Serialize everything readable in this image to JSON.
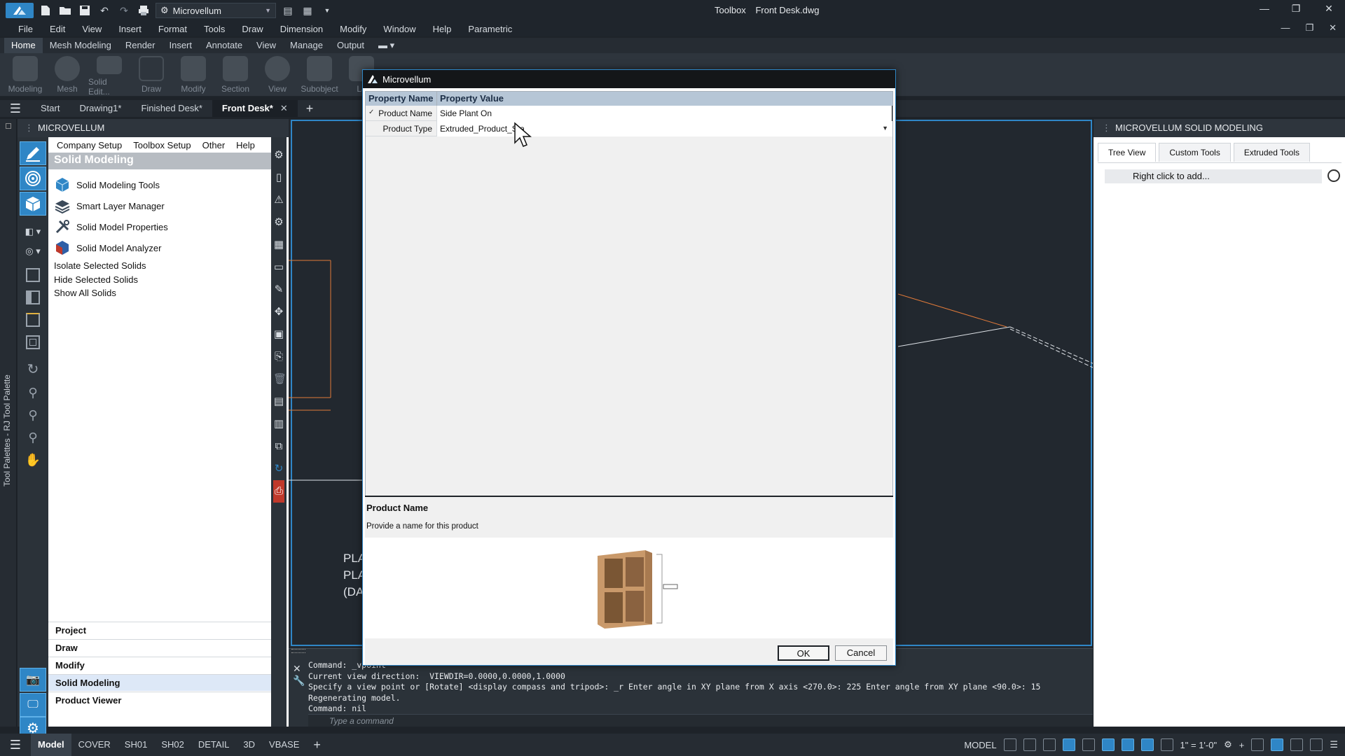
{
  "titlebar": {
    "workspace": "Microvellum",
    "app_name": "Toolbox",
    "file_name": "Front Desk.dwg"
  },
  "menubar": {
    "items": [
      "File",
      "Edit",
      "View",
      "Insert",
      "Format",
      "Tools",
      "Draw",
      "Dimension",
      "Modify",
      "Window",
      "Help",
      "Parametric"
    ]
  },
  "ribbon": {
    "tabs": [
      "Home",
      "Mesh Modeling",
      "Render",
      "Insert",
      "Annotate",
      "View",
      "Manage",
      "Output"
    ],
    "active_tab": "Home",
    "buttons": [
      "Modeling",
      "Mesh",
      "Solid Edit...",
      "Draw",
      "Modify",
      "Section",
      "View",
      "Subobject",
      "La"
    ]
  },
  "doc_tabs": {
    "items": [
      "Start",
      "Drawing1*",
      "Finished Desk*",
      "Front Desk*"
    ],
    "active": "Front Desk*"
  },
  "left_strip": {
    "label": "Tool Palettes - RJ Tool Palette"
  },
  "mv_panel": {
    "header": "MICROVELLUM",
    "menu": [
      "Company Setup",
      "Toolbox Setup",
      "Other",
      "Help"
    ],
    "section": "Solid Modeling",
    "tools": [
      "Solid Modeling Tools",
      "Smart Layer Manager",
      "Solid Model Properties",
      "Solid Model Analyzer"
    ],
    "links": [
      "Isolate Selected Solids",
      "Hide Selected Solids",
      "Show All Solids"
    ],
    "categories": [
      "Project",
      "Draw",
      "Modify",
      "Solid Modeling",
      "Product Viewer"
    ],
    "active_category": "Solid Modeling"
  },
  "right_panel": {
    "header": "MICROVELLUM SOLID MODELING",
    "tabs": [
      "Tree View",
      "Custom Tools",
      "Extruded Tools"
    ],
    "active_tab": "Tree View",
    "add_hint": "Right click to add..."
  },
  "canvas": {
    "text_lines": [
      "PLA",
      "PLA",
      "(DA"
    ]
  },
  "command_line": {
    "lines": [
      "Command: _vpoint",
      "Current view direction:  VIEWDIR=0.0000,0.0000,1.0000",
      "Specify a view point or [Rotate] <display compass and tripod>: _r Enter angle in XY plane from X axis <270.0>: 225 Enter angle from XY plane <90.0>: 15",
      "Regenerating model.",
      "Command: nil"
    ],
    "placeholder": "Type a command"
  },
  "statusbar": {
    "tabs": [
      "Model",
      "COVER",
      "SH01",
      "SH02",
      "DETAIL",
      "3D",
      "VBASE"
    ],
    "active": "Model",
    "mode": "MODEL",
    "scale": "1\" = 1'-0\""
  },
  "dialog": {
    "title": "Microvellum",
    "col_name": "Property Name",
    "col_value": "Property Value",
    "rows": [
      {
        "name": "Product Name",
        "value": "Side Plant On"
      },
      {
        "name": "Product Type",
        "value": "Extruded_Product_Sta"
      }
    ],
    "desc_title": "Product Name",
    "desc_text": "Provide a name for this product",
    "ok_label": "OK",
    "cancel_label": "Cancel"
  },
  "colors": {
    "accent": "#2f86c6",
    "dark_bg": "#1e2329",
    "grid_header": "#b6c6d6"
  }
}
